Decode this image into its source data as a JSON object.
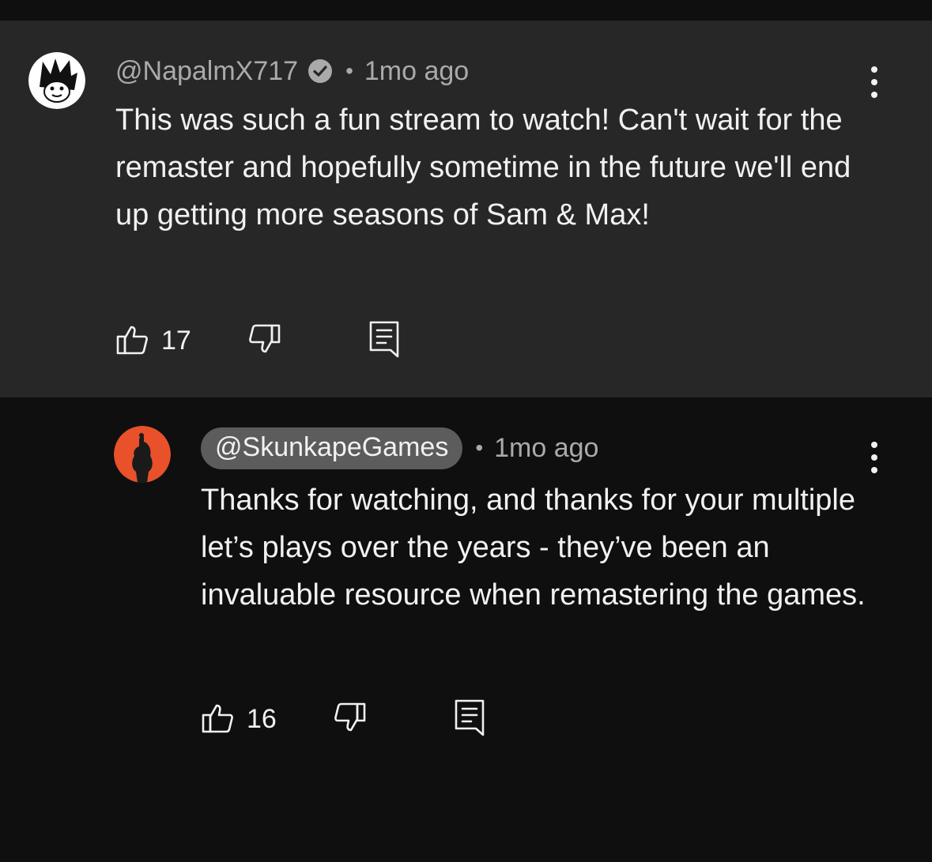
{
  "comments": [
    {
      "handle": "@NapalmX717",
      "verified": true,
      "separator": "•",
      "time": "1mo ago",
      "text": "This was such a fun stream to watch! Can't wait for the remaster and hopefully sometime in the future we'll end up getting more seasons of Sam & Max!",
      "likes": "17",
      "icons": {
        "avatar": "cartoon-avatar",
        "like": "thumbs-up-icon",
        "dislike": "thumbs-down-icon",
        "reply": "reply-icon",
        "menu": "more-vertical-icon"
      }
    },
    {
      "handle": "@SkunkapeGames",
      "creator_badge": true,
      "separator": "•",
      "time": "1mo ago",
      "text": "Thanks for watching, and thanks for your multiple let’s plays over the years - they’ve been an invaluable resource when remastering the games.",
      "likes": "16",
      "icons": {
        "avatar": "creator-avatar",
        "like": "thumbs-up-icon",
        "dislike": "thumbs-down-icon",
        "reply": "reply-icon",
        "menu": "more-vertical-icon"
      }
    }
  ],
  "colors": {
    "background": "#0f0f0f",
    "highlight_background": "#272727",
    "text_primary": "#f1f1f1",
    "text_secondary": "#aaaaaa",
    "creator_chip": "#5c5c5c",
    "avatar_orange": "#e8512a"
  }
}
